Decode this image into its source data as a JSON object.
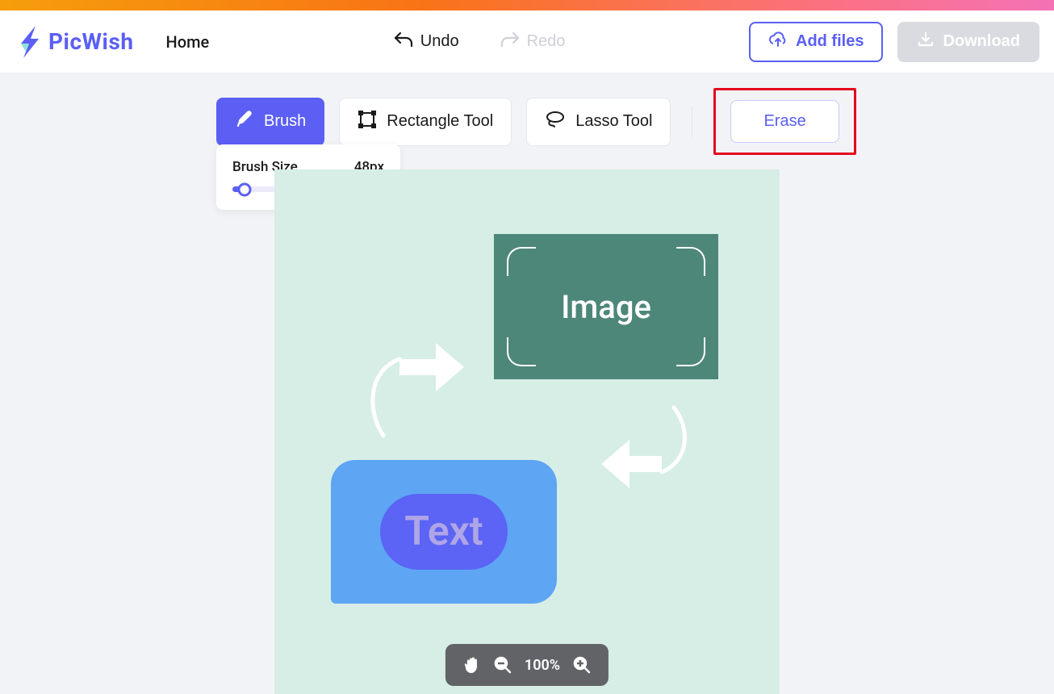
{
  "brand": "PicWish",
  "nav": {
    "home": "Home"
  },
  "actions": {
    "undo": "Undo",
    "redo": "Redo",
    "add_files": "Add files",
    "download": "Download"
  },
  "tools": {
    "brush": "Brush",
    "rectangle": "Rectangle Tool",
    "lasso": "Lasso Tool",
    "erase": "Erase"
  },
  "brush_panel": {
    "label": "Brush Size",
    "value": "48px"
  },
  "canvas": {
    "image_label": "Image",
    "text_label": "Text"
  },
  "zoom": {
    "level": "100%"
  }
}
